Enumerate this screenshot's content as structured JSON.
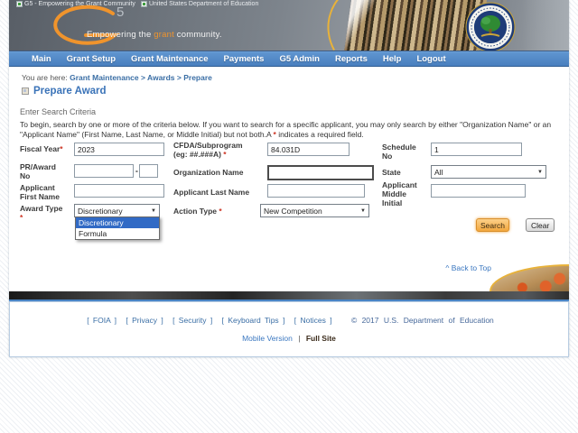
{
  "page": {
    "alt_bar": {
      "items": [
        "G5 - Empowering the Grant Community",
        "United States Department of Education"
      ]
    },
    "banner": {
      "logo_number": "5",
      "tagline_prefix": "Empowering the ",
      "tagline_highlight": "grant",
      "tagline_suffix": " community."
    },
    "nav": {
      "items": [
        "Main",
        "Grant Setup",
        "Grant Maintenance",
        "Payments",
        "G5 Admin",
        "Reports",
        "Help",
        "Logout"
      ]
    },
    "breadcrumb": {
      "prefix": "You are here: ",
      "path": "Grant Maintenance > Awards > Prepare"
    },
    "title": "Prepare Award",
    "search_criteria": {
      "heading": "Enter Search Criteria",
      "instructions_before": "To begin, search by one or more of the criteria below. If you want to search for a specific applicant, you may only search by either \"Organization Name\" or an \"Applicant Name\" (First Name, Last Name, or Middle Initial) but not both.A ",
      "instructions_star": "*",
      "instructions_after": " indicates a required field."
    },
    "form": {
      "fiscal_year": {
        "label": "Fiscal Year",
        "required": "*",
        "value": "2023"
      },
      "cfda": {
        "label_line1": "CFDA/Subprogram",
        "label_line2": "(eg: ##.###A) ",
        "required": "*",
        "value": "84.031D"
      },
      "schedule_no": {
        "label": "Schedule No",
        "value": "1"
      },
      "pr_award_no": {
        "label": "PR/Award No",
        "value1": "",
        "separator": "-",
        "value2": ""
      },
      "organization_name": {
        "label": "Organization Name",
        "value": ""
      },
      "state": {
        "label": "State",
        "value": "All"
      },
      "applicant_first_name": {
        "label": "Applicant First Name",
        "value": ""
      },
      "applicant_last_name": {
        "label": "Applicant Last Name",
        "value": ""
      },
      "applicant_middle_initial": {
        "label": "Applicant Middle Initial",
        "value": ""
      },
      "award_type": {
        "label": "Award Type",
        "required": "*",
        "value": "Discretionary",
        "options": [
          "Discretionary",
          "Formula"
        ],
        "selected_option": "Discretionary"
      },
      "action_type": {
        "label": "Action Type ",
        "required": "*",
        "value": "New Competition"
      },
      "search_button": "Search",
      "clear_button": "Clear"
    },
    "back_to_top": "^ Back to Top",
    "footer": {
      "links": [
        "[ FOIA ]",
        "[ Privacy ]",
        "[ Security ]",
        "[ Keyboard Tips ]",
        "[ Notices ]"
      ],
      "copyright": "© 2017 U.S. Department of Education",
      "mobile_version": "Mobile Version",
      "separator": "|",
      "full_site": "Full Site"
    },
    "icons": {
      "dropdown_arrow": "▼"
    },
    "colors": {
      "nav_blue": "#4d87c7",
      "link_blue": "#3a6ea5",
      "logo_orange": "#f0942c",
      "required_red": "#cc3322",
      "option_highlight_blue": "#316ac5",
      "search_button_orange": "#f2a73e"
    }
  }
}
